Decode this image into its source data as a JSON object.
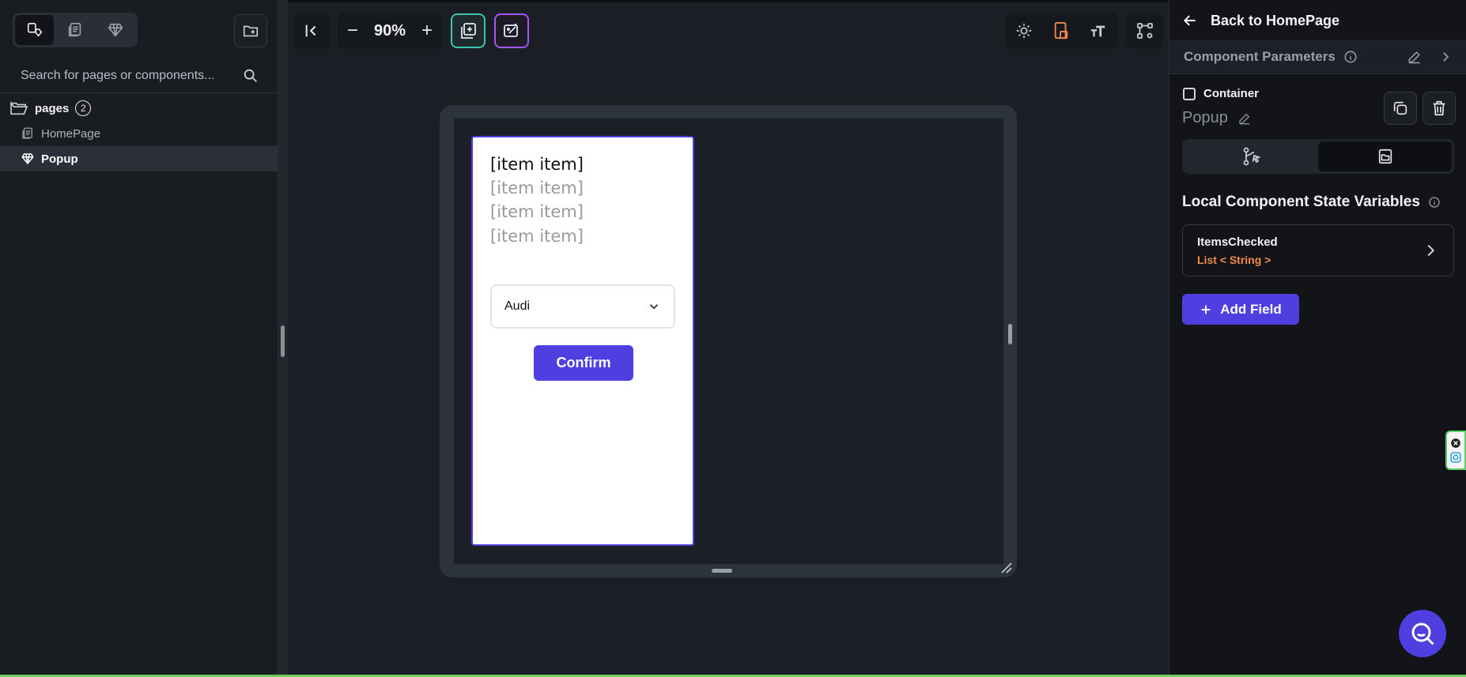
{
  "left_sidebar": {
    "search_placeholder": "Search for pages or components...",
    "tree": {
      "folder_label": "pages",
      "folder_count": "2",
      "items": [
        {
          "label": "HomePage",
          "icon": "page-icon"
        },
        {
          "label": "Popup",
          "icon": "component-icon",
          "selected": true
        }
      ]
    }
  },
  "toolbar": {
    "zoom_level": "90%",
    "zoom_out": "−",
    "zoom_in": "+"
  },
  "canvas": {
    "items": [
      "[item item]",
      "[item item]",
      "[item item]",
      "[item item]"
    ],
    "dropdown_value": "Audi",
    "confirm_label": "Confirm"
  },
  "right_panel": {
    "back_label": "Back to HomePage",
    "section_title": "Component Parameters",
    "widget_type": "Container",
    "component_name": "Popup",
    "state_vars_title": "Local Component State Variables",
    "variables": [
      {
        "name": "ItemsChecked",
        "type": "List < String >"
      }
    ],
    "add_field_label": "Add Field"
  },
  "colors": {
    "accent": "#4f3ee0",
    "teal": "#39c6b0",
    "purple": "#a855f7",
    "orange": "#f08a4b"
  }
}
